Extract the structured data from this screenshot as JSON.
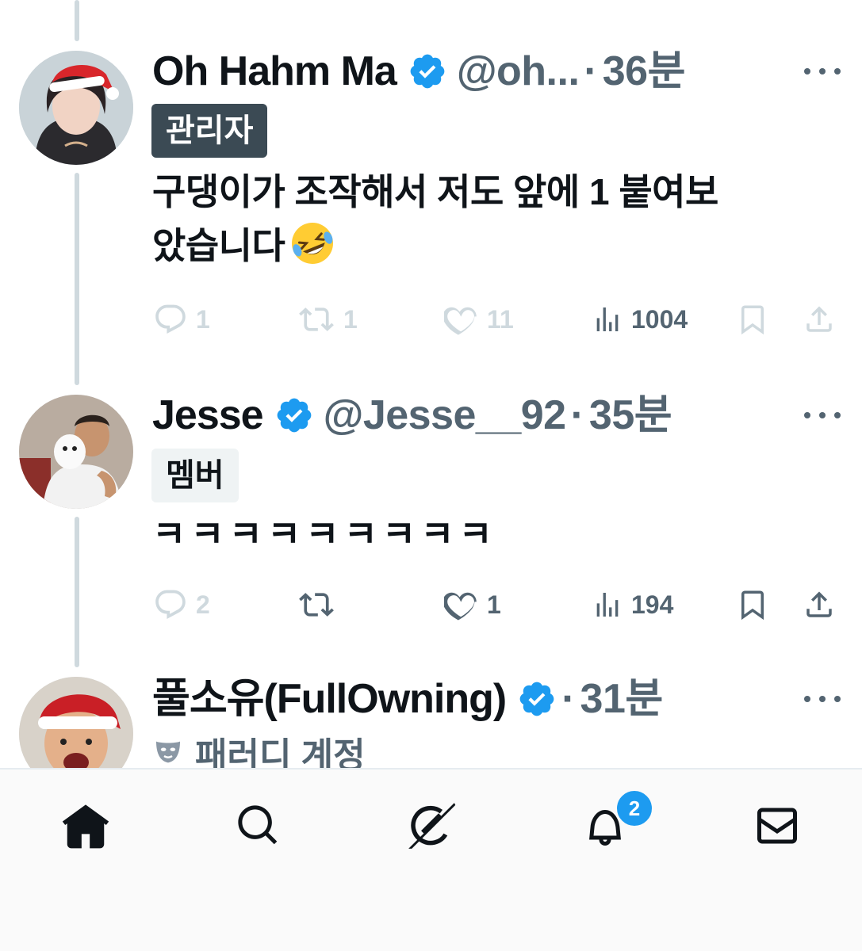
{
  "posts": [
    {
      "name": "Oh Hahm Ma",
      "handle": "@oh...",
      "time": "36분",
      "badge": "관리자",
      "text_line1": "구댕이가 조작해서 저도 앞에 1 붙여보",
      "text_line2": "았습니다",
      "emoji": "🤣",
      "replies": "1",
      "reposts": "1",
      "likes": "11",
      "views": "1004"
    },
    {
      "name": "Jesse",
      "handle": "@Jesse__92",
      "time": "35분",
      "badge": "멤버",
      "text_line1": "ㅋㅋㅋㅋㅋㅋㅋㅋㅋ",
      "replies": "2",
      "reposts": "",
      "likes": "1",
      "views": "194"
    },
    {
      "name": "풀소유(FullOwning)",
      "handle": "",
      "time": "31분",
      "label": "패러디 계정"
    }
  ],
  "separator": "·",
  "tabbar": {
    "items": [
      "home-icon",
      "search-icon",
      "grok-icon",
      "notifications-icon",
      "messages-icon"
    ],
    "notification_count": "2"
  },
  "colors": {
    "accent": "#1d9bf0",
    "text": "#0f1419",
    "secondary": "#536471",
    "faded": "#cfd9de"
  }
}
